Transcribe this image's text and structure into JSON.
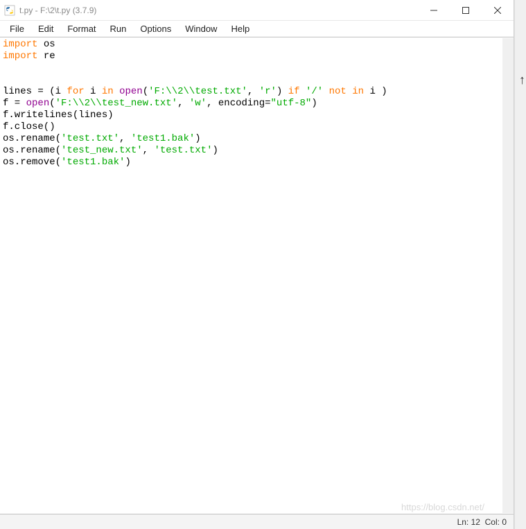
{
  "window": {
    "title": "t.py - F:\\2\\t.py (3.7.9)",
    "icon_name": "python-idle-icon"
  },
  "menu": {
    "items": [
      "File",
      "Edit",
      "Format",
      "Run",
      "Options",
      "Window",
      "Help"
    ]
  },
  "code": {
    "lines": [
      {
        "tokens": [
          {
            "t": "import",
            "c": "kw-orange"
          },
          {
            "t": " os",
            "c": ""
          }
        ]
      },
      {
        "tokens": [
          {
            "t": "import",
            "c": "kw-orange"
          },
          {
            "t": " re",
            "c": ""
          }
        ]
      },
      {
        "tokens": []
      },
      {
        "tokens": []
      },
      {
        "tokens": [
          {
            "t": "lines = (i ",
            "c": ""
          },
          {
            "t": "for",
            "c": "kw-orange"
          },
          {
            "t": " i ",
            "c": ""
          },
          {
            "t": "in",
            "c": "kw-orange"
          },
          {
            "t": " ",
            "c": ""
          },
          {
            "t": "open",
            "c": "kw-purple"
          },
          {
            "t": "(",
            "c": ""
          },
          {
            "t": "'F:\\\\2\\\\test.txt'",
            "c": "str-green"
          },
          {
            "t": ", ",
            "c": ""
          },
          {
            "t": "'r'",
            "c": "str-green"
          },
          {
            "t": ") ",
            "c": ""
          },
          {
            "t": "if",
            "c": "kw-orange"
          },
          {
            "t": " ",
            "c": ""
          },
          {
            "t": "'/'",
            "c": "str-green"
          },
          {
            "t": " ",
            "c": ""
          },
          {
            "t": "not",
            "c": "kw-orange"
          },
          {
            "t": " ",
            "c": ""
          },
          {
            "t": "in",
            "c": "kw-orange"
          },
          {
            "t": " i )",
            "c": ""
          }
        ]
      },
      {
        "tokens": [
          {
            "t": "f = ",
            "c": ""
          },
          {
            "t": "open",
            "c": "kw-purple"
          },
          {
            "t": "(",
            "c": ""
          },
          {
            "t": "'F:\\\\2\\\\test_new.txt'",
            "c": "str-green"
          },
          {
            "t": ", ",
            "c": ""
          },
          {
            "t": "'w'",
            "c": "str-green"
          },
          {
            "t": ", encoding=",
            "c": ""
          },
          {
            "t": "\"utf-8\"",
            "c": "str-green"
          },
          {
            "t": ")",
            "c": ""
          }
        ]
      },
      {
        "tokens": [
          {
            "t": "f.writelines(lines)",
            "c": ""
          }
        ]
      },
      {
        "tokens": [
          {
            "t": "f.close()",
            "c": ""
          }
        ]
      },
      {
        "tokens": [
          {
            "t": "os.rename(",
            "c": ""
          },
          {
            "t": "'test.txt'",
            "c": "str-green"
          },
          {
            "t": ", ",
            "c": ""
          },
          {
            "t": "'test1.bak'",
            "c": "str-green"
          },
          {
            "t": ")",
            "c": ""
          }
        ]
      },
      {
        "tokens": [
          {
            "t": "os.rename(",
            "c": ""
          },
          {
            "t": "'test_new.txt'",
            "c": "str-green"
          },
          {
            "t": ", ",
            "c": ""
          },
          {
            "t": "'test.txt'",
            "c": "str-green"
          },
          {
            "t": ")",
            "c": ""
          }
        ]
      },
      {
        "tokens": [
          {
            "t": "os.remove(",
            "c": ""
          },
          {
            "t": "'test1.bak'",
            "c": "str-green"
          },
          {
            "t": ")",
            "c": ""
          }
        ]
      }
    ]
  },
  "status": {
    "line": 12,
    "col": 0,
    "ln_label": "Ln:",
    "col_label": "Col:"
  },
  "watermark": "https://blog.csdn.net/"
}
